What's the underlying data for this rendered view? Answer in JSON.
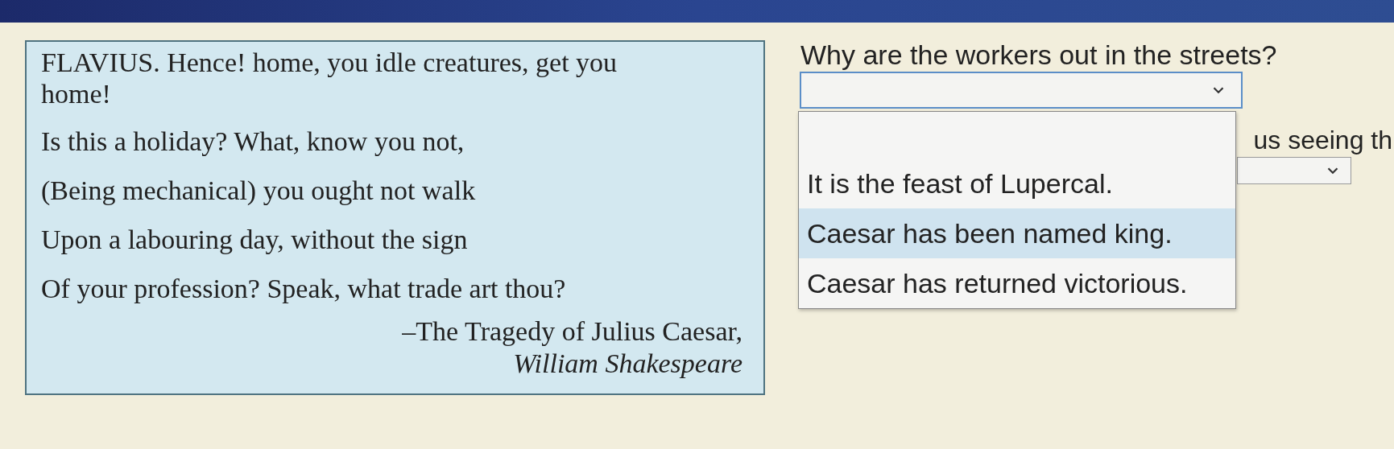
{
  "passage": {
    "lines": [
      "FLAVIUS. Hence! home, you idle creatures, get you home!",
      "Is this a holiday? What, know you not,",
      "(Being mechanical) you ought not walk",
      "Upon a labouring day, without the sign",
      "Of your profession? Speak, what trade art thou?"
    ],
    "source": "–The Tragedy of Julius Caesar,",
    "author": "William Shakespeare"
  },
  "question": {
    "prompt": "Why are the workers out in the streets?",
    "dropdown": {
      "expanded": true,
      "options": [
        {
          "label": "It is the feast of Lupercal.",
          "highlighted": false
        },
        {
          "label": "Caesar has been named king.",
          "highlighted": true
        },
        {
          "label": "Caesar has returned victorious.",
          "highlighted": false
        }
      ]
    }
  },
  "next_question": {
    "prompt": "us seeing th"
  }
}
